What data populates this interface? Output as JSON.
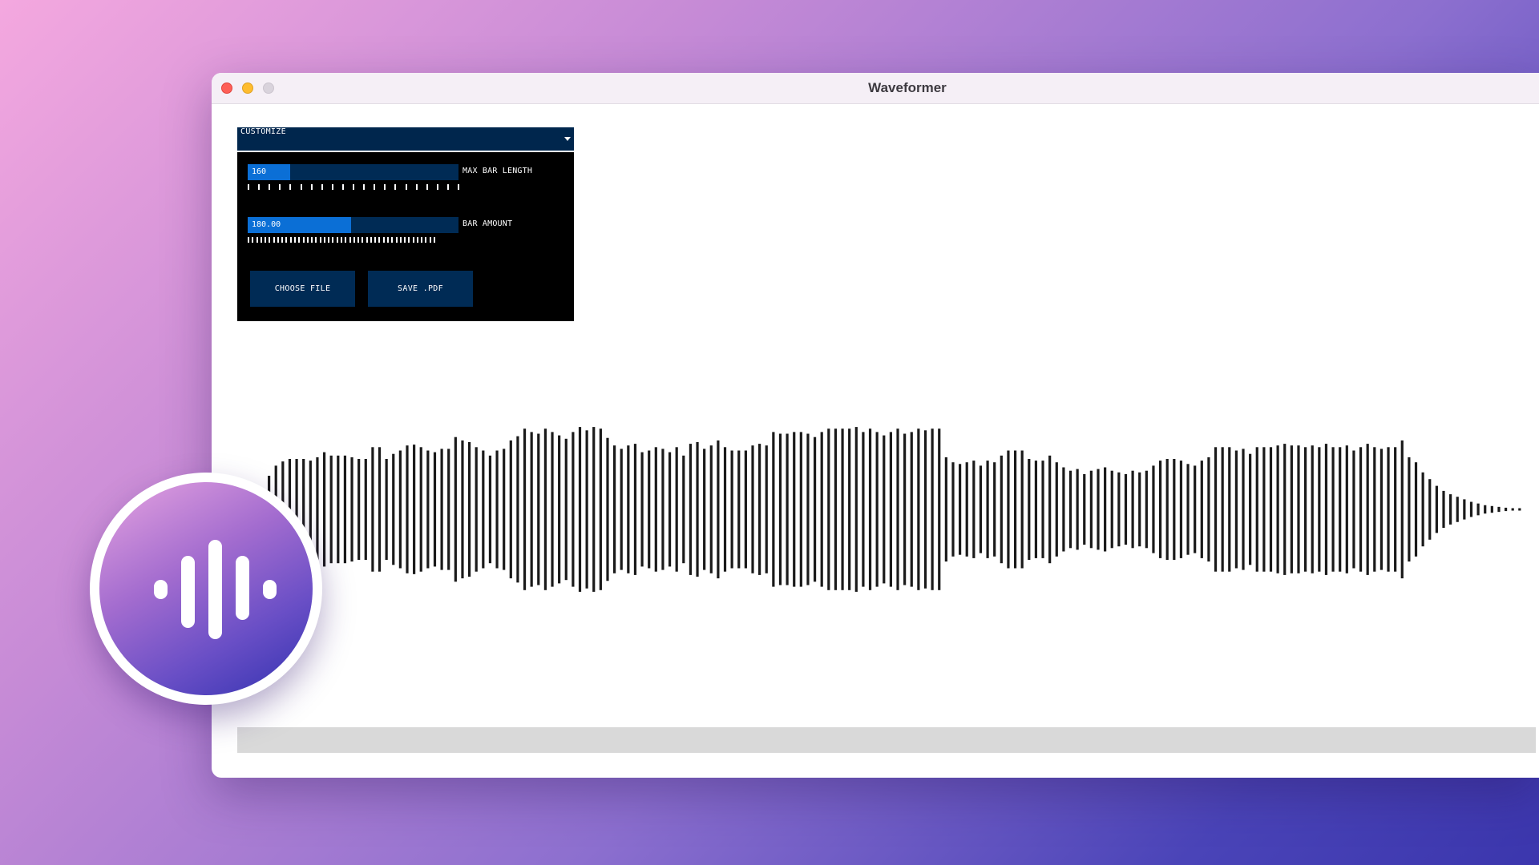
{
  "window": {
    "title": "Waveformer"
  },
  "panel": {
    "header_label": "CUSTOMIZE",
    "sliders": [
      {
        "value_text": "160",
        "label": "MAX BAR LENGTH",
        "fill_fraction": 0.2
      },
      {
        "value_text": "180.00",
        "label": "BAR AMOUNT",
        "fill_fraction": 0.49
      }
    ],
    "buttons": {
      "choose_file": "CHOOSE FILE",
      "save_pdf": "SAVE .PDF"
    }
  },
  "waveform": {
    "bar_amount": 180,
    "max_bar_length": 160,
    "bar_color": "#1a1a1a",
    "amplitudes": [
      0.4,
      0.52,
      0.57,
      0.6,
      0.6,
      0.6,
      0.58,
      0.62,
      0.68,
      0.64,
      0.64,
      0.64,
      0.62,
      0.6,
      0.6,
      0.74,
      0.74,
      0.6,
      0.66,
      0.7,
      0.76,
      0.77,
      0.74,
      0.7,
      0.68,
      0.72,
      0.72,
      0.86,
      0.82,
      0.8,
      0.74,
      0.7,
      0.64,
      0.7,
      0.72,
      0.82,
      0.87,
      0.96,
      0.92,
      0.9,
      0.96,
      0.92,
      0.88,
      0.84,
      0.92,
      0.98,
      0.94,
      0.98,
      0.96,
      0.85,
      0.76,
      0.72,
      0.76,
      0.78,
      0.68,
      0.7,
      0.74,
      0.72,
      0.68,
      0.74,
      0.64,
      0.78,
      0.8,
      0.72,
      0.76,
      0.82,
      0.74,
      0.7,
      0.7,
      0.7,
      0.76,
      0.78,
      0.76,
      0.92,
      0.9,
      0.9,
      0.92,
      0.92,
      0.9,
      0.86,
      0.92,
      0.96,
      0.96,
      0.96,
      0.96,
      0.98,
      0.92,
      0.96,
      0.92,
      0.88,
      0.92,
      0.96,
      0.9,
      0.92,
      0.96,
      0.94,
      0.96,
      0.96,
      0.62,
      0.56,
      0.54,
      0.56,
      0.58,
      0.52,
      0.58,
      0.56,
      0.64,
      0.7,
      0.7,
      0.7,
      0.6,
      0.58,
      0.58,
      0.64,
      0.56,
      0.5,
      0.46,
      0.48,
      0.42,
      0.46,
      0.48,
      0.5,
      0.46,
      0.44,
      0.42,
      0.46,
      0.44,
      0.46,
      0.52,
      0.58,
      0.6,
      0.6,
      0.58,
      0.54,
      0.52,
      0.58,
      0.62,
      0.74,
      0.74,
      0.74,
      0.7,
      0.72,
      0.66,
      0.74,
      0.74,
      0.74,
      0.76,
      0.78,
      0.76,
      0.76,
      0.74,
      0.76,
      0.74,
      0.78,
      0.74,
      0.74,
      0.76,
      0.7,
      0.74,
      0.78,
      0.74,
      0.72,
      0.74,
      0.74,
      0.82,
      0.62,
      0.56,
      0.44,
      0.36,
      0.28,
      0.22,
      0.18,
      0.15,
      0.12,
      0.09,
      0.07,
      0.05,
      0.04,
      0.03,
      0.02,
      0.01,
      0.01
    ]
  },
  "app_icon": {
    "name": "waveform-icon",
    "gradient": [
      "#e7a4e0",
      "#3232b0"
    ]
  }
}
